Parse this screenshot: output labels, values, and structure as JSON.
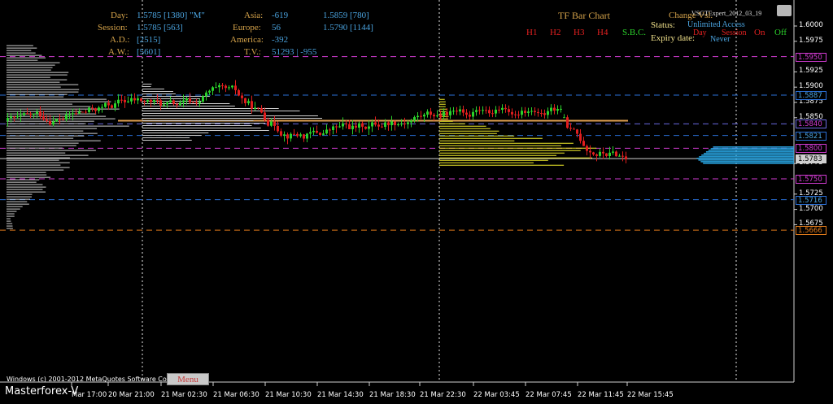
{
  "stats": {
    "day_label": "Day:",
    "day_value": "1.5785  [1380]  \"M\"",
    "session_label": "Session:",
    "session_value": "1.5785  [563]",
    "ad_label": "A.D.:",
    "ad_value": "[2515]",
    "aw_label": "A.W.:",
    "aw_value": "[5601]",
    "asia_label": "Asia:",
    "asia_value": "-619",
    "asia_price": "1.5859 [780]",
    "europe_label": "Europe:",
    "europe_value": "56",
    "europe_price": "1.5790 [1144]",
    "america_label": "America:",
    "america_value": "-392",
    "tv_label": "T.V.:",
    "tv_value": "51293 | -955"
  },
  "tf_bar_chart": {
    "title": "TF Bar Chart",
    "buttons": [
      "H1",
      "H2",
      "H3",
      "H4"
    ],
    "sbc": "S.B.C."
  },
  "license": {
    "expert_name": "VSGTExpert_2012_03_19",
    "change_label": "Change  Vsl.",
    "status_label": "Status:",
    "status_value": "Unlimited Access",
    "expiry_label": "Expiry date:",
    "expiry_value": "Never",
    "day_toggle": "Day",
    "session_toggle": "Session",
    "on_label": "On",
    "off_label": "Off"
  },
  "price_axis": [
    "1.6000",
    "1.5975",
    "1.5925",
    "1.5900",
    "1.5875",
    "1.5850",
    "1.5775",
    "1.5725",
    "1.5700",
    "1.5675"
  ],
  "price_tags": [
    {
      "text": "1.5950",
      "color": "#d23bd2",
      "text_color": "#d23bd2"
    },
    {
      "text": "1.5887",
      "color": "#2a6fd6",
      "text_color": "#4aa3df"
    },
    {
      "text": "1.5840",
      "color": "#6a6adf",
      "text_color": "#d23bd2"
    },
    {
      "text": "1.5821",
      "color": "#2a6fd6",
      "text_color": "#4aa3df"
    },
    {
      "text": "1.5800",
      "color": "#d23bd2",
      "text_color": "#d23bd2"
    },
    {
      "text": "1.5783",
      "color": "#cfcfcf",
      "text_color": "#000"
    },
    {
      "text": "1.5750",
      "color": "#d23bd2",
      "text_color": "#d23bd2"
    },
    {
      "text": "1.5716",
      "color": "#2a6fd6",
      "text_color": "#4aa3df"
    },
    {
      "text": "1.5666",
      "color": "#e07a1a",
      "text_color": "#e07a1a"
    }
  ],
  "time_axis": [
    "Mar 17:00",
    "20 Mar 21:00",
    "21 Mar 02:30",
    "21 Mar 06:30",
    "21 Mar 10:30",
    "21 Mar 14:30",
    "21 Mar 18:30",
    "21 Mar 22:30",
    "22 Mar 03:45",
    "22 Mar 07:45",
    "22 Mar 11:45",
    "22 Mar 15:45"
  ],
  "footer": {
    "watermark": "Masterforex-V",
    "copyright": "Windows (c) 2001-2012 MetaQuotes Software Corp.",
    "menu": "Menu"
  },
  "colors": {
    "bull": "#2bd12b",
    "bear": "#e01e1e",
    "profile_gray": "#cfcfcf",
    "profile_yellow": "#f2ee2a",
    "profile_blue": "#29a9e8",
    "poc_line": "#e0a050"
  }
}
